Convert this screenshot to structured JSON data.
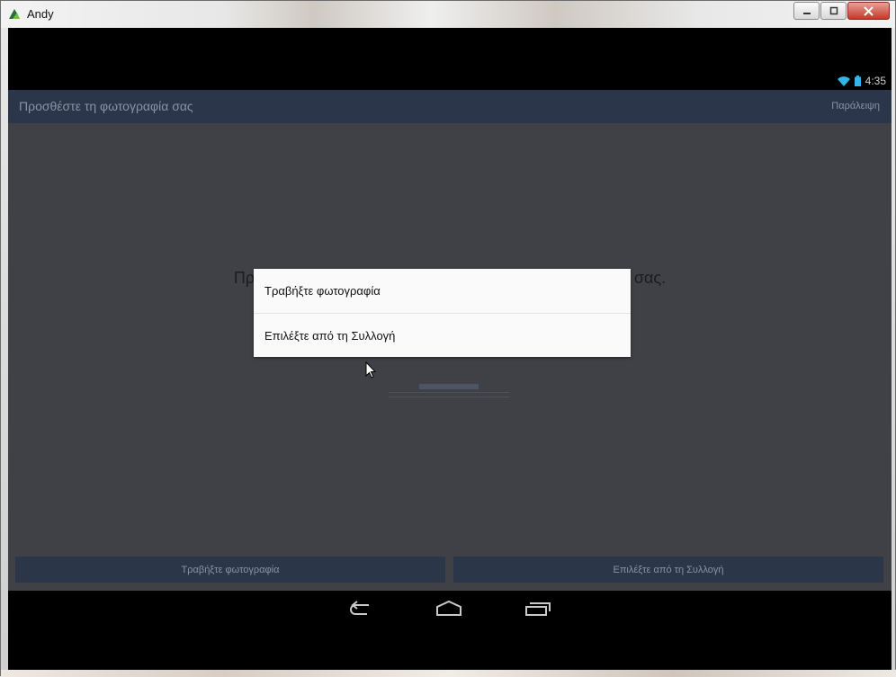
{
  "window": {
    "title": "Andy",
    "buttons": {
      "minimize": "–",
      "restore": "□",
      "close": "✕"
    }
  },
  "status_bar": {
    "time": "4:35",
    "icons": [
      "wifi-icon",
      "battery-icon"
    ]
  },
  "action_bar": {
    "title": "Προσθέστε τη φωτογραφία σας",
    "skip": "Παράλειψη"
  },
  "content": {
    "prompt": "Προσθέστε εικόνα προφίλ, για να σας βρίσκουν οι φίλοι σας."
  },
  "bottom_buttons": {
    "take_photo": "Τραβήξτε φωτογραφία",
    "choose_gallery": "Επιλέξτε από τη Συλλογή"
  },
  "dialog": {
    "items": [
      {
        "label": "Τραβήξτε φωτογραφία"
      },
      {
        "label": "Επιλέξτε από τη Συλλογή"
      }
    ]
  },
  "nav_bar": {
    "icons": [
      "back-icon",
      "home-icon",
      "recent-apps-icon"
    ]
  },
  "colors": {
    "action_bar": "#2b364b",
    "content_dim": "#3f4146",
    "dialog_bg": "#fafafa",
    "status_accent": "#33b5e5"
  }
}
